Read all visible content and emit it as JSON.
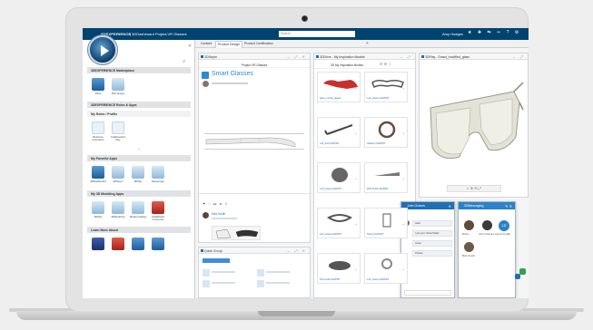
{
  "topbar": {
    "brand": "3DEXPERIENCE",
    "title": "| 3DDashboard Project:VR Glasses",
    "search_placeholder": "Search",
    "user": "Amy Hodges"
  },
  "left": {
    "sections": [
      {
        "title": "3DEXPERIENCE Marketplace"
      },
      {
        "title": "3DEXPERIENCE Roles & Apps"
      },
      {
        "title": "My Roles / Profile"
      },
      {
        "title": "My Favorite Apps"
      },
      {
        "title": "My 3D Modeling Apps"
      },
      {
        "title": "Learn More About"
      }
    ],
    "marketplace_apps": [
      "Parts",
      "Part Supply"
    ],
    "roles": [
      "Business Innovation",
      "Collaborative Play"
    ],
    "favorites": [
      "3DDashboard",
      "3DSwym",
      "3DPlay",
      "Messenger"
    ],
    "modeling": [
      "3DPlay",
      "3DModeling",
      "Model Catalog",
      "SolidWorks Connector"
    ]
  },
  "tabs": [
    {
      "label": "Content"
    },
    {
      "label": "Product Design"
    },
    {
      "label": "Product Certification"
    }
  ],
  "swym": {
    "title": "3DSwym",
    "community": "Project VR Glasses",
    "post_title": "Smart Glasses",
    "banner": "A PERFECT MIXTURE OF TECHNOLOGY AND DESIGN",
    "comment_author": "Alex Smith",
    "reply_hint": "Write a comment"
  },
  "drive": {
    "title": "3DDrive - My Inspiration Models",
    "folder": "3D My Inspiration Models",
    "items": [
      {
        "label": "glass_model_glass1"
      },
      {
        "label": "Loft_sweep SLDPRT"
      },
      {
        "label": "cuff_final SLDPRT"
      },
      {
        "label": "Glasses SLDPRT"
      },
      {
        "label": "Loft_sweep SLDPRT"
      },
      {
        "label": "PRT-SLDS SLDPRT"
      },
      {
        "label": "Loft_sweep SLDPRT"
      },
      {
        "label": "Spring SLDPRT"
      },
      {
        "label": "PN-model SLDPRT"
      },
      {
        "label": "Loft_sweep SLDPRT"
      }
    ]
  },
  "play": {
    "title": "3DPlay - Smart_modified_glass"
  },
  "group": {
    "title": "Quick Group"
  },
  "chats": {
    "left_title": "John Graves",
    "right_title": "3DMessaging",
    "right_users": [
      "Brent",
      "John Graves",
      "Laura Knight",
      "Bob Smith"
    ],
    "messages": [
      "Hello",
      "I got your shared folder",
      "Great",
      "Thanks"
    ]
  },
  "colors": {
    "navbar": "#00436f",
    "accent": "#2a8ad8",
    "chat_header": "#1f6fb3",
    "chat_header2": "#2b82c6",
    "badge": "#2ea44f"
  }
}
